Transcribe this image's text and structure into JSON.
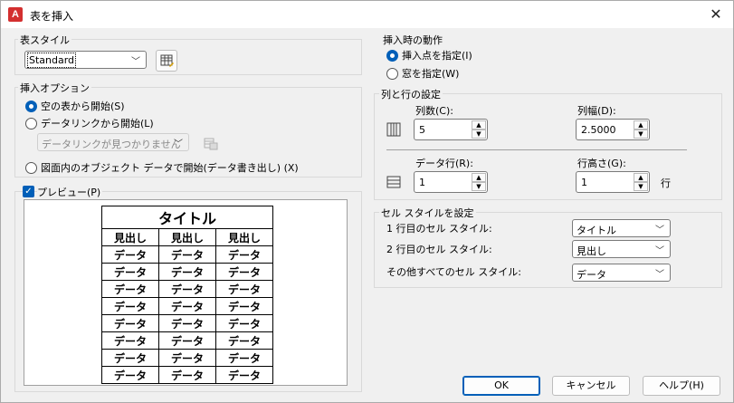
{
  "window": {
    "title": "表を挿入",
    "app_icon_letter": "A"
  },
  "table_style": {
    "group_label": "表スタイル",
    "value": "Standard"
  },
  "insert_options": {
    "group_label": "挿入オプション",
    "options": [
      {
        "label": "空の表から開始(S)",
        "selected": true
      },
      {
        "label": "データリンクから開始(L)",
        "selected": false
      },
      {
        "label": "図面内のオブジェクト データで開始(データ書き出し) (X)",
        "selected": false
      }
    ],
    "datalink_value": "データリンクが見つかりません"
  },
  "preview": {
    "label": "プレビュー(P)",
    "checked": true,
    "table_title": "タイトル",
    "header_cells": [
      "見出し",
      "見出し",
      "見出し"
    ],
    "data_rows": [
      [
        "データ",
        "データ",
        "データ"
      ],
      [
        "データ",
        "データ",
        "データ"
      ],
      [
        "データ",
        "データ",
        "データ"
      ],
      [
        "データ",
        "データ",
        "データ"
      ],
      [
        "データ",
        "データ",
        "データ"
      ],
      [
        "データ",
        "データ",
        "データ"
      ],
      [
        "データ",
        "データ",
        "データ"
      ],
      [
        "データ",
        "データ",
        "データ"
      ]
    ]
  },
  "insert_behavior": {
    "group_label": "挿入時の動作",
    "options": [
      {
        "label": "挿入点を指定(I)",
        "selected": true
      },
      {
        "label": "窓を指定(W)",
        "selected": false
      }
    ]
  },
  "col_row_settings": {
    "group_label": "列と行の設定",
    "columns_label": "列数(C):",
    "columns_value": "5",
    "col_width_label": "列幅(D):",
    "col_width_value": "2.5000",
    "data_rows_label": "データ行(R):",
    "data_rows_value": "1",
    "row_height_label": "行高さ(G):",
    "row_height_value": "1",
    "row_unit": "行"
  },
  "cell_styles": {
    "group_label": "セル スタイルを設定",
    "rows": [
      {
        "label": "1 行目のセル スタイル:",
        "value": "タイトル"
      },
      {
        "label": "2 行目のセル スタイル:",
        "value": "見出し"
      },
      {
        "label": "その他すべてのセル スタイル:",
        "value": "データ"
      }
    ]
  },
  "buttons": {
    "ok": "OK",
    "cancel": "キャンセル",
    "help": "ヘルプ(H)"
  },
  "colors": {
    "accent": "#005fb8",
    "app_icon": "#d32f2f"
  }
}
